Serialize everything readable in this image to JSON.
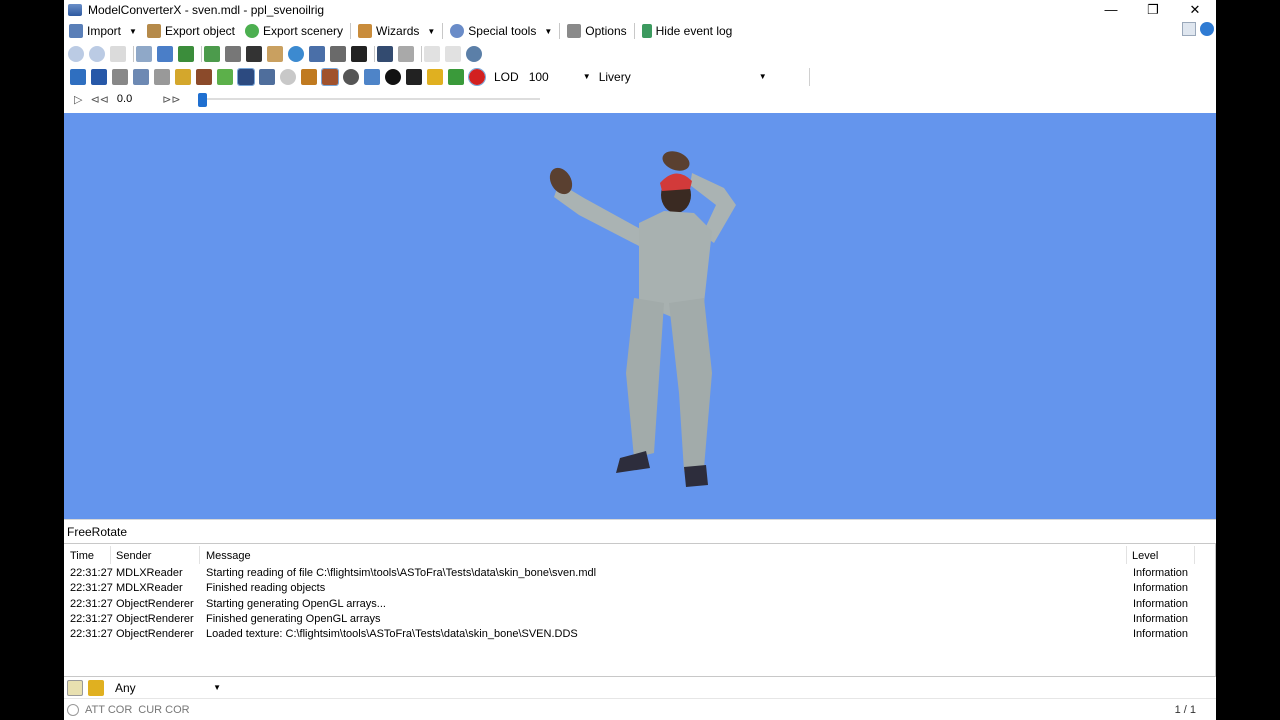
{
  "window": {
    "title": "ModelConverterX - sven.mdl - ppl_svenoilrig",
    "controls": [
      "—",
      "❐",
      "✕"
    ]
  },
  "menubar": {
    "import": "Import",
    "export_object": "Export object",
    "export_scenery": "Export scenery",
    "wizards": "Wizards",
    "special_tools": "Special tools",
    "options": "Options",
    "hide_event_log": "Hide event log"
  },
  "toolbar2": {
    "lod_label": "LOD",
    "lod_value": "100",
    "livery_value": "Livery"
  },
  "playback": {
    "time": "0.0",
    "position_fraction": 0.0
  },
  "viewport": {
    "background": "#6495ED",
    "mode": "FreeRotate"
  },
  "log": {
    "columns": {
      "time": "Time",
      "sender": "Sender",
      "message": "Message",
      "level": "Level"
    },
    "rows": [
      {
        "time": "22:31:27",
        "sender": "MDLXReader",
        "message": "Starting reading of file C:\\flightsim\\tools\\ASToFra\\Tests\\data\\skin_bone\\sven.mdl",
        "level": "Information"
      },
      {
        "time": "22:31:27",
        "sender": "MDLXReader",
        "message": "Finished reading objects",
        "level": "Information"
      },
      {
        "time": "22:31:27",
        "sender": "ObjectRenderer",
        "message": "Starting generating OpenGL arrays...",
        "level": "Information"
      },
      {
        "time": "22:31:27",
        "sender": "ObjectRenderer",
        "message": "Finished generating OpenGL arrays",
        "level": "Information"
      },
      {
        "time": "22:31:27",
        "sender": "ObjectRenderer",
        "message": "Loaded texture: C:\\flightsim\\tools\\ASToFra\\Tests\\data\\skin_bone\\SVEN.DDS",
        "level": "Information"
      }
    ]
  },
  "filter": {
    "value": "Any"
  },
  "statusbar": {
    "att_cor": "ATT COR",
    "cur_cor": "CUR COR",
    "page": "1 / 1"
  }
}
